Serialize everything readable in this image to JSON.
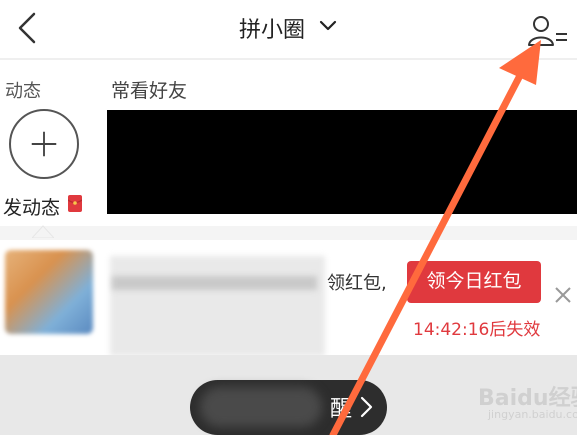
{
  "header": {
    "title": "拼小圈",
    "icons": [
      "back-arrow",
      "chevron-down",
      "user-list-menu"
    ]
  },
  "section_labels": {
    "left": "动态",
    "friends": "常看好友"
  },
  "post_action": {
    "label": "发动态",
    "icon": "red-envelope"
  },
  "card": {
    "visible_snippet": "领红包,",
    "button_label": "领今日红包",
    "expire_text": "14:42:16后失效",
    "accent_color": "#e0393e"
  },
  "bottom_bar": {
    "pill_text": "醒"
  },
  "watermark": {
    "text": "Baidu经验",
    "sub": "jingyan.baidu.com"
  },
  "annotation": {
    "arrow_color": "#ff6a3d"
  }
}
